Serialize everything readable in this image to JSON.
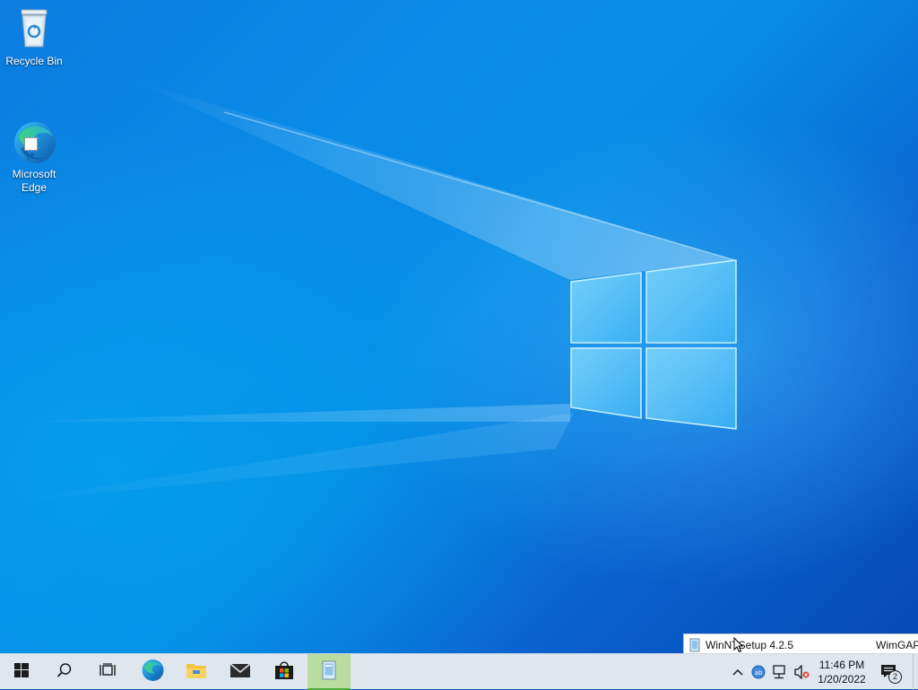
{
  "desktop": {
    "icons": [
      {
        "label": "Recycle Bin",
        "icon": "recycle-bin-icon"
      },
      {
        "label": "Microsoft\nEdge",
        "icon": "edge-icon"
      }
    ]
  },
  "taskbar": {
    "buttons": [
      {
        "name": "start",
        "icon": "windows-logo-icon"
      },
      {
        "name": "search",
        "icon": "search-icon"
      },
      {
        "name": "task-view",
        "icon": "task-view-icon"
      },
      {
        "name": "edge",
        "icon": "edge-icon"
      },
      {
        "name": "file-explorer",
        "icon": "folder-icon"
      },
      {
        "name": "mail",
        "icon": "mail-icon"
      },
      {
        "name": "store",
        "icon": "store-icon"
      },
      {
        "name": "winntsetup",
        "icon": "setup-app-icon",
        "active": true
      }
    ],
    "tray": {
      "icons": [
        "chevron-up-icon",
        "network-adapter-icon",
        "network-icon",
        "volume-muted-icon"
      ],
      "time": "11:46 PM",
      "date": "1/20/2022",
      "notification_count": "2"
    },
    "popup": {
      "items": [
        {
          "label": "WinNTSetup 4.2.5"
        },
        {
          "label": "WimGAP"
        }
      ]
    }
  },
  "colors": {
    "taskbar_bg": "#dfe6ee",
    "active_app_bg": "#b9dd9e",
    "wallpaper_blue": "#0a7ae0"
  }
}
